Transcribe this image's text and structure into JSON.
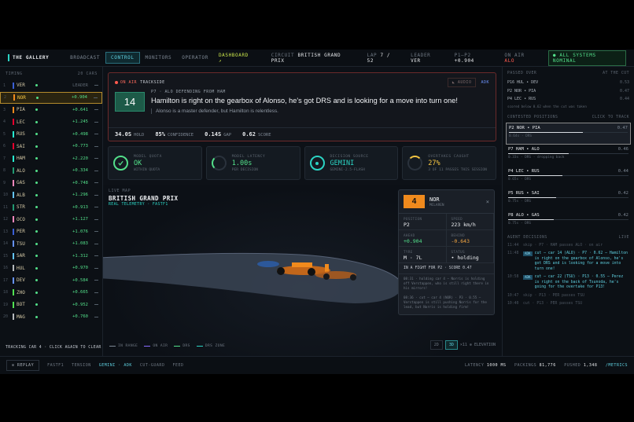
{
  "topnav": {
    "brand": "THE GALLERY",
    "tabs": [
      "BROADCAST",
      "CONTROL",
      "MONITORS",
      "OPERATOR"
    ],
    "dashboard": "DASHBOARD ↗",
    "circuit_label": "CIRCUIT",
    "circuit": "BRITISH GRAND PRIX",
    "lap_label": "LAP",
    "lap": "7 / 52",
    "leader_label": "LEADER",
    "leader": "VER",
    "p1p2_label": "P1–P2",
    "p1p2": "+0.904",
    "onair_label": "ON AIR",
    "onair": "ALO",
    "systems": "● ALL SYSTEMS NOMINAL"
  },
  "timing": {
    "title": "TIMING",
    "count": "20 CARS",
    "rows": [
      {
        "pos": "1",
        "code": "VER",
        "gap": "LEADER",
        "color": "#3a5fd6"
      },
      {
        "pos": "2",
        "code": "NOR",
        "gap": "+0.904",
        "color": "#f08a1d"
      },
      {
        "pos": "3",
        "code": "PIA",
        "gap": "+0.641",
        "color": "#f08a1d"
      },
      {
        "pos": "4",
        "code": "LEC",
        "gap": "+1.245",
        "color": "#e8002d"
      },
      {
        "pos": "5",
        "code": "RUS",
        "gap": "+0.498",
        "color": "#27f4d2"
      },
      {
        "pos": "6",
        "code": "SAI",
        "gap": "+0.773",
        "color": "#e8002d"
      },
      {
        "pos": "7",
        "code": "HAM",
        "gap": "+2.220",
        "color": "#27f4d2"
      },
      {
        "pos": "8",
        "code": "ALO",
        "gap": "+0.334",
        "color": "#229971"
      },
      {
        "pos": "9",
        "code": "GAS",
        "gap": "+0.748",
        "color": "#ff87bc"
      },
      {
        "pos": "10",
        "code": "ALB",
        "gap": "+1.296",
        "color": "#64c4ff"
      },
      {
        "pos": "11",
        "code": "STR",
        "gap": "+0.913",
        "color": "#229971"
      },
      {
        "pos": "12",
        "code": "OCO",
        "gap": "+1.127",
        "color": "#ff87bc"
      },
      {
        "pos": "13",
        "code": "PER",
        "gap": "+1.076",
        "color": "#3a5fd6"
      },
      {
        "pos": "14",
        "code": "TSU",
        "gap": "+1.083",
        "color": "#6692ff"
      },
      {
        "pos": "15",
        "code": "SAR",
        "gap": "+1.312",
        "color": "#64c4ff"
      },
      {
        "pos": "16",
        "code": "HUL",
        "gap": "+0.970",
        "color": "#b6babd"
      },
      {
        "pos": "17",
        "code": "DEV",
        "gap": "+0.584",
        "color": "#6692ff"
      },
      {
        "pos": "18",
        "code": "ZHO",
        "gap": "+0.665",
        "color": "#52e252"
      },
      {
        "pos": "19",
        "code": "BOT",
        "gap": "+0.952",
        "color": "#52e252"
      },
      {
        "pos": "20",
        "code": "MAG",
        "gap": "+0.760",
        "color": "#b6babd"
      }
    ],
    "hint": "TRACKING CAR 4 · CLICK AGAIN TO CLEAR"
  },
  "onair": {
    "label": "ON AIR",
    "sub": "TRACKSIDE",
    "audio": "AUDIO",
    "adk": "ADK",
    "position": "14",
    "context": "P7 · ALO DEFENDING FROM HAM",
    "headline": "Hamilton is right on the gearbox of Alonso, he's got DRS and is looking for a move into turn one!",
    "quote": "Alonso is a master defender, but Hamilton is relentless.",
    "stats": [
      {
        "value": "34.0S",
        "label": "HOLD"
      },
      {
        "value": "85%",
        "label": "CONFIDENCE"
      },
      {
        "value": "0.14S",
        "label": "GAP"
      },
      {
        "value": "0.62",
        "label": "SCORE"
      }
    ]
  },
  "cards": [
    {
      "label": "MODEL QUOTA",
      "value": "OK",
      "sub": "WITHIN QUOTA",
      "color": "#53e08a",
      "icon": "check-icon"
    },
    {
      "label": "MODEL LATENCY",
      "value": "1.00s",
      "sub": "PER DECISION",
      "color": "#53e08a",
      "icon": "gauge-icon"
    },
    {
      "label": "DECISION SOURCE",
      "value": "GEMINI",
      "sub": "GEMINI-2.5-FLASH",
      "color": "#2bd4c4",
      "icon": "spark-icon"
    },
    {
      "label": "OVERTAKES CAUGHT",
      "value": "27%",
      "sub": "3 OF 11 PASSES THIS SESSION",
      "color": "#f5c542",
      "icon": "progress-icon"
    }
  ],
  "livemap": {
    "label": "LIVE MAP",
    "title": "BRITISH GRAND PRIX",
    "sub": "REAL TELEMETRY · FASTF1",
    "legend": [
      "IN RANGE",
      "ON AIR",
      "DRS",
      "DRS ZONE"
    ],
    "zoom": [
      "2D",
      "3D"
    ],
    "elevation": "×11 ⊕ ELEVATION"
  },
  "popup": {
    "number": "4",
    "name": "NOR",
    "team": "MCLAREN",
    "fields": [
      {
        "k": "POSITION",
        "v": "P2",
        "cls": ""
      },
      {
        "k": "SPEED",
        "v": "223 km/h",
        "cls": ""
      },
      {
        "k": "AHEAD",
        "v": "+0.904",
        "cls": "g"
      },
      {
        "k": "BEHIND",
        "v": "-0.643",
        "cls": "o"
      },
      {
        "k": "TYRE",
        "v": "M · 7L",
        "cls": ""
      },
      {
        "k": "STATUS",
        "v": "• holding",
        "cls": ""
      }
    ],
    "fight": "IN A FIGHT FOR P2 · SCORE 0.47",
    "log1": "08:31 · holding car 4 — Norris is holding off Verstappen, who is still right there in his mirrors!",
    "log2": "08:36 · cut — car 4 (NOR) · P3 · 0.55 — Verstappen is still pushing Norris for the lead, but Norris is holding firm!"
  },
  "right": {
    "passed_title": "PASSED OVER",
    "passed_note_hdr": "AT THE CUT",
    "passed": [
      {
        "label": "P16 HUL • DEV",
        "score": "0.53"
      },
      {
        "label": "P2 NOR • PIA",
        "score": "0.47"
      },
      {
        "label": "P4 LEC • RUS",
        "score": "0.44"
      }
    ],
    "passed_note": "scored below 0.62 when the cut was taken",
    "contested_title": "CONTESTED POSITIONS",
    "contested_hint": "CLICK TO TRACK",
    "contested": [
      {
        "label": "P2 NOR • PIA",
        "score": "0.47",
        "meta": "0.64s · DRS",
        "fill": 0.62
      },
      {
        "label": "P7 HAM • ALO",
        "score": "0.46",
        "meta": "0.33s · DRS · dropping back",
        "fill": 0.5
      },
      {
        "label": "P4 LEC • RUS",
        "score": "0.44",
        "meta": "0.65s · DRS",
        "fill": 0.45
      },
      {
        "label": "P5 RUS • SAI",
        "score": "0.42",
        "meta": "0.75s · DRS",
        "fill": 0.4
      },
      {
        "label": "P8 ALO • GAS",
        "score": "0.42",
        "meta": "0.75s · DRS",
        "fill": 0.38
      }
    ],
    "agent_title": "AGENT DECISIONS",
    "agent_live": "LIVE",
    "decisions": [
      {
        "t": "11:44",
        "badge": "",
        "text": "skip · P7 · HAM passes ALO · on air",
        "hi": false
      },
      {
        "t": "11:48",
        "badge": "ADK",
        "text": "cut — car 14 (ALO) · P7 · 0.62 — Hamilton is right on the gearbox of Alonso, he's got DRS and is looking for a move into turn one!",
        "hi": true
      },
      {
        "t": "10:58",
        "badge": "ADK",
        "text": "cut — car 22 (TSU) · P13 · 0.55 — Perez is right on the back of Tsunoda, he's going for the overtake for P13!",
        "hi": true
      },
      {
        "t": "10:47",
        "badge": "",
        "text": "skip · P13 · PER passes TSU",
        "hi": false
      },
      {
        "t": "10:40",
        "badge": "",
        "text": "cut · P13 · PER passes TSU",
        "hi": false
      }
    ]
  },
  "bottom": {
    "replay": "⊙ REPLAY",
    "items": [
      "FASTF1",
      "TENSION",
      "GEMINI · ADK",
      "CUT-GUARD",
      "FEED"
    ],
    "latency_label": "LATENCY",
    "latency": "1000 MS",
    "packings_label": "PACKINGS",
    "packings": "81,776",
    "pushed_label": "PUSHED",
    "pushed": "1,348",
    "metrics": "/METRICS"
  }
}
